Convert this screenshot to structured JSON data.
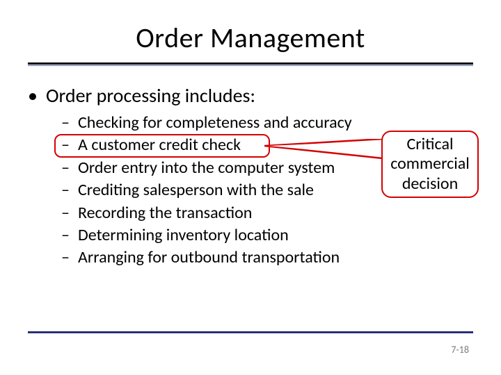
{
  "title": "Order Management",
  "bullet1": "Order processing includes:",
  "sub": [
    "Checking for completeness and accuracy",
    "A customer credit check",
    "Order entry into the computer system",
    "Crediting salesperson with the sale",
    "Recording the transaction",
    "Determining inventory location",
    "Arranging for outbound transportation"
  ],
  "callout": {
    "line1": "Critical",
    "line2": "commercial",
    "line3": "decision"
  },
  "page_number": "7-18",
  "colors": {
    "accent_red": "#d40000",
    "rule_blue": "#2a2f7a"
  }
}
